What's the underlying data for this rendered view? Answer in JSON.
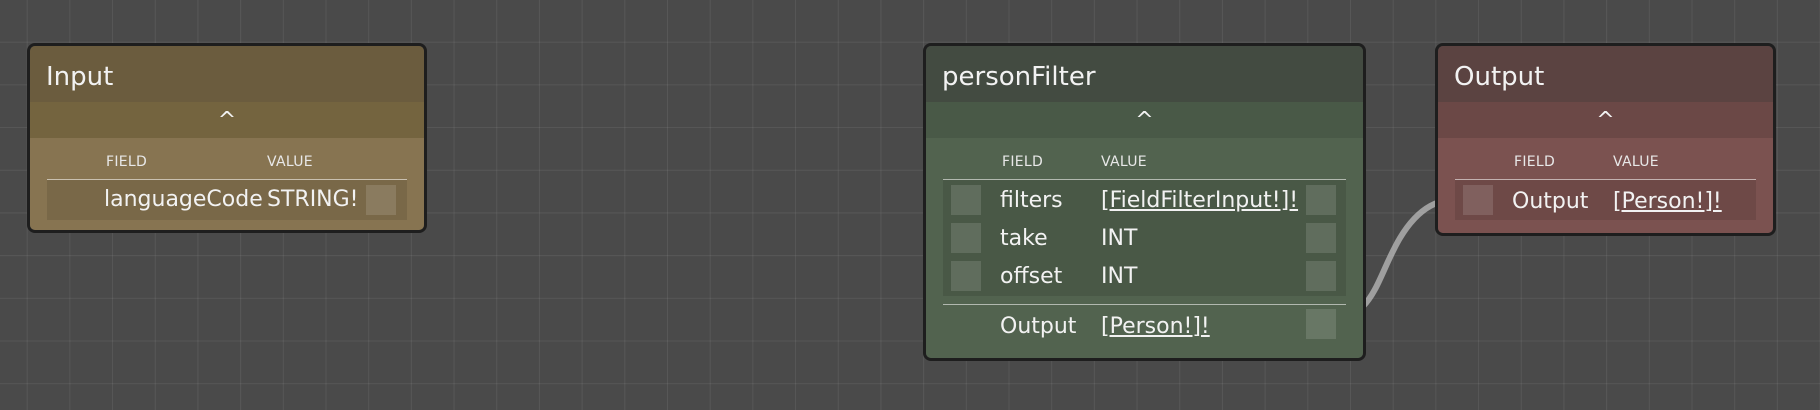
{
  "colors": {
    "canvas_bg": "#4a4a4a",
    "input_node": "#877451",
    "filter_node": "#52634f",
    "output_node": "#7b5250",
    "wire": "#bcbcbc"
  },
  "input_node": {
    "title": "Input",
    "collapse_icon": "^",
    "field_header": "FIELD",
    "value_header": "VALUE",
    "rows": [
      {
        "field": "languageCode",
        "value": "STRING!"
      }
    ]
  },
  "filter_node": {
    "title": "personFilter",
    "collapse_icon": "^",
    "field_header": "FIELD",
    "value_header": "VALUE",
    "rows": [
      {
        "field": "filters",
        "value": "[FieldFilterInput!]!"
      },
      {
        "field": "take",
        "value": "INT"
      },
      {
        "field": "offset",
        "value": "INT"
      }
    ],
    "output": {
      "field": "Output",
      "value": "[Person!]!"
    }
  },
  "output_node": {
    "title": "Output",
    "collapse_icon": "^",
    "field_header": "FIELD",
    "value_header": "VALUE",
    "rows": [
      {
        "field": "Output",
        "value": "[Person!]!"
      }
    ]
  }
}
